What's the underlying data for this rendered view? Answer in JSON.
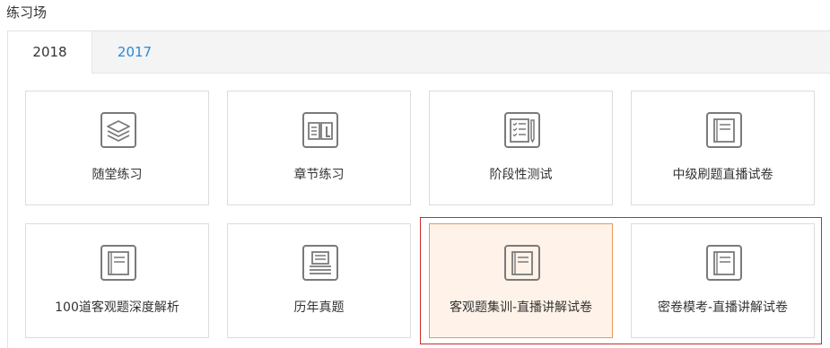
{
  "page": {
    "title": "练习场"
  },
  "tabs": [
    {
      "label": "2018",
      "active": true
    },
    {
      "label": "2017",
      "active": false
    }
  ],
  "cards": [
    {
      "label": "随堂练习",
      "icon": "layers-icon"
    },
    {
      "label": "章节练习",
      "icon": "open-book-icon"
    },
    {
      "label": "阶段性测试",
      "icon": "checklist-icon"
    },
    {
      "label": "中级刷题直播试卷",
      "icon": "notebook-icon"
    },
    {
      "label": "100道客观题深度解析",
      "icon": "notebook-icon"
    },
    {
      "label": "历年真题",
      "icon": "document-stack-icon"
    },
    {
      "label": "客观题集训-直播讲解试卷",
      "icon": "notebook-icon",
      "selected": true
    },
    {
      "label": "密卷模考-直播讲解试卷",
      "icon": "notebook-icon"
    }
  ],
  "colors": {
    "accent_blue": "#2b88d8",
    "selected_bg": "#fff3e9",
    "selected_border": "#e7995b",
    "highlight_red": "#cc2b2b",
    "icon_gray": "#7a7a7a"
  }
}
